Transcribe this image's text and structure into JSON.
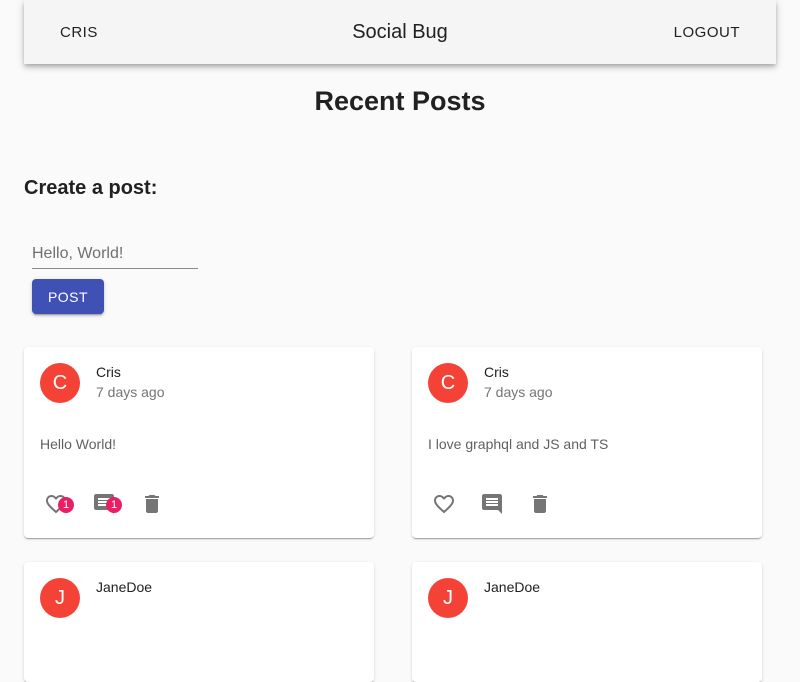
{
  "header": {
    "user_label": "CRIS",
    "app_title": "Social Bug",
    "logout_label": "LOGOUT"
  },
  "page": {
    "title": "Recent Posts",
    "create_heading": "Create a post:"
  },
  "composer": {
    "placeholder": "Hello, World!",
    "value": "",
    "button_label": "POST"
  },
  "posts": [
    {
      "avatar_letter": "C",
      "author": "Cris",
      "time": "7 days ago",
      "body": "Hello World!",
      "like_count": "1",
      "comment_count": "1"
    },
    {
      "avatar_letter": "C",
      "author": "Cris",
      "time": "7 days ago",
      "body": "I love graphql and JS and TS"
    },
    {
      "avatar_letter": "J",
      "author": "JaneDoe"
    },
    {
      "avatar_letter": "J",
      "author": "JaneDoe"
    }
  ],
  "colors": {
    "primary": "#3f51b5",
    "avatar": "#f44336",
    "badge": "#e91e63",
    "icon": "#757575"
  },
  "icons": {
    "like": "heart-outline-icon",
    "comment_with_count": "comment-lines-icon",
    "comment": "chat-bubble-icon",
    "delete": "trash-icon"
  }
}
